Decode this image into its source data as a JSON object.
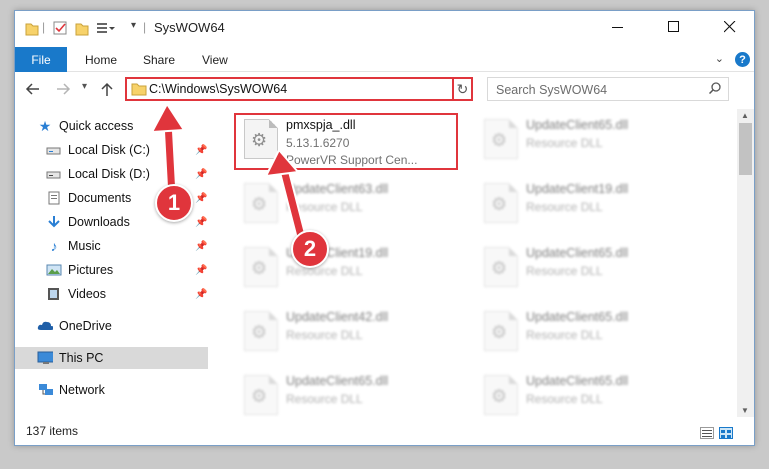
{
  "window": {
    "title": "SysWOW64"
  },
  "ribbon": {
    "file": "File",
    "tabs": [
      "Home",
      "Share",
      "View"
    ],
    "help": "?"
  },
  "nav": {
    "address": "C:\\Windows\\SysWOW64",
    "search_placeholder": "Search SysWOW64"
  },
  "sidebar": {
    "items": [
      {
        "label": "Quick access",
        "icon": "star-icon"
      },
      {
        "label": "Local Disk (C:)",
        "icon": "drive-icon"
      },
      {
        "label": "Local Disk (D:)",
        "icon": "drive-icon"
      },
      {
        "label": "Documents",
        "icon": "documents-icon"
      },
      {
        "label": "Downloads",
        "icon": "download-icon"
      },
      {
        "label": "Music",
        "icon": "music-icon"
      },
      {
        "label": "Pictures",
        "icon": "pictures-icon"
      },
      {
        "label": "Videos",
        "icon": "video-icon"
      },
      {
        "label": "OneDrive",
        "icon": "cloud-icon"
      },
      {
        "label": "This PC",
        "icon": "computer-icon"
      },
      {
        "label": "Network",
        "icon": "network-icon"
      }
    ]
  },
  "files": {
    "highlighted": {
      "name": "pmxspja_.dll",
      "version": "5.13.1.6270",
      "description": "PowerVR Support Cen..."
    },
    "blurred": [
      {
        "name": "UpdateClient65.dll",
        "desc": "Resource DLL"
      },
      {
        "name": "UpdateClient63.dll",
        "desc": "Resource DLL"
      },
      {
        "name": "UpdateClient19.dll",
        "desc": "Resource DLL"
      },
      {
        "name": "UpdateClient19.dll",
        "desc": "Resource DLL"
      },
      {
        "name": "UpdateClient65.dll",
        "desc": "Resource DLL"
      },
      {
        "name": "UpdateClient42.dll",
        "desc": "Resource DLL"
      },
      {
        "name": "UpdateClient65.dll",
        "desc": "Resource DLL"
      },
      {
        "name": "UpdateClient65.dll",
        "desc": "Resource DLL"
      },
      {
        "name": "UpdateClient65.dll",
        "desc": "Resource DLL"
      }
    ]
  },
  "status": {
    "count": "137 items"
  },
  "annotations": {
    "step1": "1",
    "step2": "2",
    "color": "#e0353c"
  }
}
